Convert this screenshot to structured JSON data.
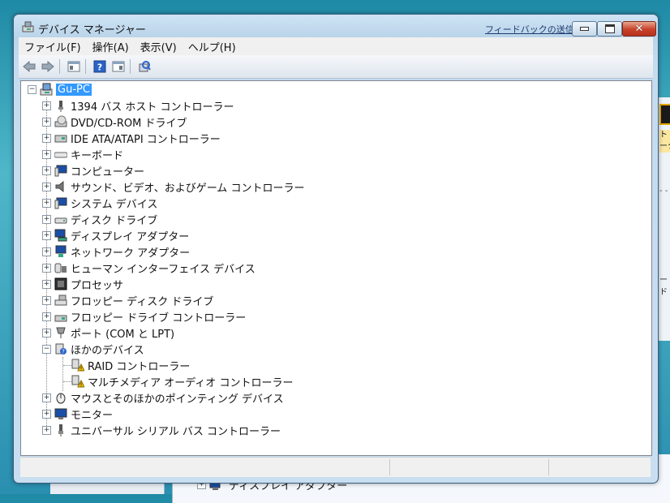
{
  "background": {
    "partial_tree_item": "ディスプレイ アダプター",
    "right_fragment_1": "ト\nーク",
    "right_fragment_2": "ード"
  },
  "window": {
    "title": "デバイス マネージャー",
    "feedback_link": "フィードバックの送信"
  },
  "menu": {
    "items": [
      "ファイル(F)",
      "操作(A)",
      "表示(V)",
      "ヘルプ(H)"
    ]
  },
  "toolbar": {
    "icons": [
      "back-icon",
      "forward-icon",
      "properties-icon",
      "help-icon",
      "show-hide-icon",
      "scan-hardware-icon"
    ]
  },
  "tree": {
    "root": "Gu-PC",
    "categories": [
      "1394 バス ホスト コントローラー",
      "DVD/CD-ROM ドライブ",
      "IDE ATA/ATAPI コントローラー",
      "キーボード",
      "コンピューター",
      "サウンド、ビデオ、およびゲーム コントローラー",
      "システム デバイス",
      "ディスク ドライブ",
      "ディスプレイ アダプター",
      "ネットワーク アダプター",
      "ヒューマン インターフェイス デバイス",
      "プロセッサ",
      "フロッピー ディスク ドライブ",
      "フロッピー ドライブ コントローラー",
      "ポート (COM と LPT)",
      "ほかのデバイス",
      "マウスとそのほかのポインティング デバイス",
      "モニター",
      "ユニバーサル シリアル バス コントローラー"
    ],
    "other_devices_children": [
      "RAID コントローラー",
      "マルチメディア オーディオ コントローラー"
    ]
  },
  "colors": {
    "selection": "#3399ff",
    "close_button": "#c8412a",
    "warning": "#f5c400"
  }
}
